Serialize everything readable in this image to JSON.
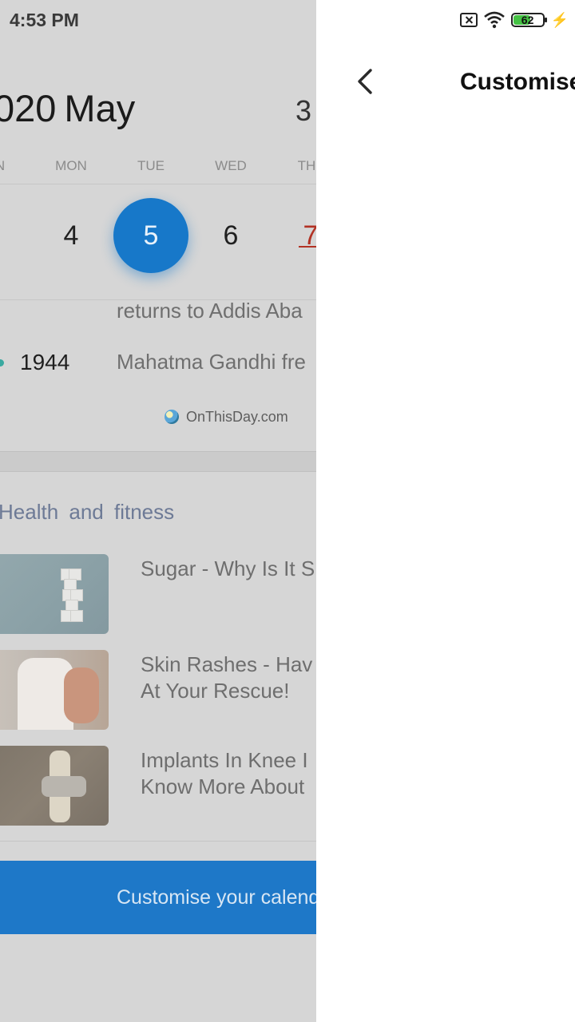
{
  "status_bar": {
    "time": "4:53 PM",
    "battery_level": "62",
    "battery_fraction": 0.62
  },
  "calendar": {
    "year_fragment": "020",
    "month": "May",
    "icon_text": "3",
    "weekdays": [
      "N",
      "MON",
      "TUE",
      "WED",
      "TH"
    ],
    "days": [
      {
        "label": "4",
        "state": "normal"
      },
      {
        "label": "5",
        "state": "selected"
      },
      {
        "label": "6",
        "state": "normal"
      },
      {
        "label": "7",
        "state": "holiday"
      }
    ]
  },
  "on_this_day": {
    "events": [
      {
        "year": "",
        "text": "returns to Addis Aba"
      },
      {
        "year": "1944",
        "text": "Mahatma Gandhi fre"
      }
    ],
    "source": "OnThisDay.com"
  },
  "health": {
    "title": "Health  and  fitness",
    "articles": [
      {
        "title_lines": [
          "Sugar - Why Is It S"
        ]
      },
      {
        "title_lines": [
          "Skin Rashes - Hav",
          "At Your Rescue!"
        ]
      },
      {
        "title_lines": [
          "Implants In Knee I",
          "Know More About"
        ]
      }
    ]
  },
  "cta": {
    "label": "Customise your calend"
  },
  "customise_page": {
    "title": "Customise"
  },
  "colors": {
    "accent": "#1778c9",
    "cta_blue": "#1e78c8",
    "holiday_red": "#b23224",
    "battery_green": "#45c244"
  }
}
